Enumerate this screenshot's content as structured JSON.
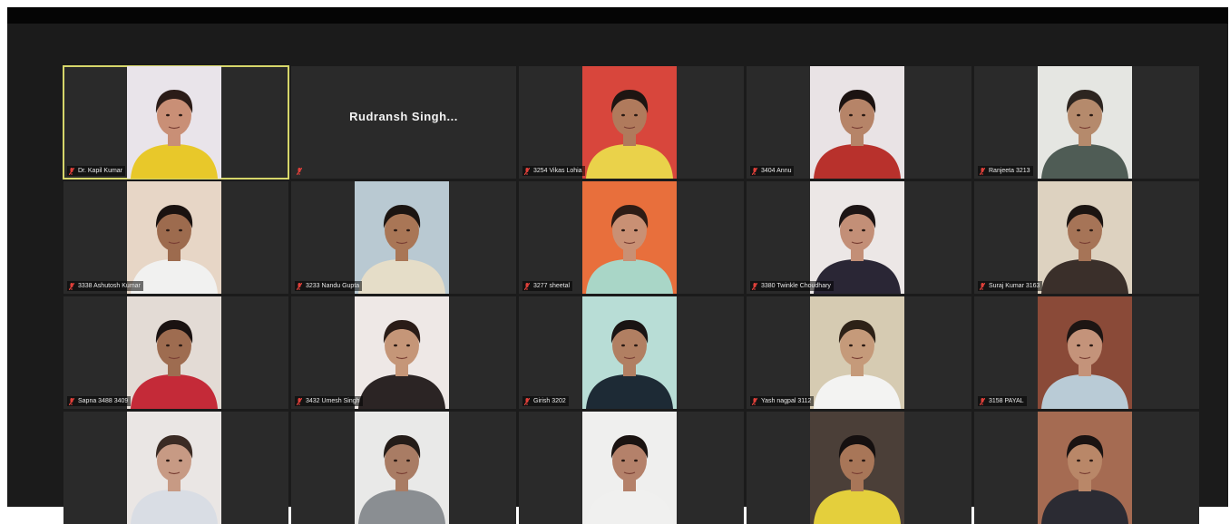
{
  "colors": {
    "tile_bg": "#2a2a2a",
    "active_speaker_border": "#d6d66a",
    "muted_mic": "#e0403a"
  },
  "participants": [
    {
      "label": "Dr. Kapil Kumar",
      "shirt": "#e8c82a",
      "wall": "#e9e4ea",
      "skin": "#c98f76",
      "hair": "#2b1c18",
      "active": true
    },
    {
      "name_display": "Rudransh  Singh...",
      "label": "",
      "no_video": true
    },
    {
      "label": "3254 Vikas Lohia",
      "shirt": "#ead24a",
      "wall": "#d8463c",
      "skin": "#b07a5c",
      "hair": "#1e1512"
    },
    {
      "label": "3404 Annu",
      "shirt": "#b8312c",
      "wall": "#e9e3e5",
      "skin": "#b68468",
      "hair": "#1c1311"
    },
    {
      "label": "Ranjeeta 3213",
      "shirt": "#4f5c55",
      "wall": "#e5e6e2",
      "skin": "#b58a6c",
      "hair": "#2d2520"
    },
    {
      "label": "3338 Ashutosh Kumar",
      "shirt": "#f1f1f0",
      "wall": "#e7d6c6",
      "skin": "#9d6b4e",
      "hair": "#1a1210"
    },
    {
      "label": "3233 Nandu Gupta",
      "shirt": "#e5ddc8",
      "wall": "#b9c9d2",
      "skin": "#a97656",
      "hair": "#1b1411"
    },
    {
      "label": "3277 sheetal",
      "shirt": "#a9d6c7",
      "wall": "#e86f3c",
      "skin": "#c99074",
      "hair": "#2e1c15"
    },
    {
      "label": "3380 Twinkle Choudhary",
      "shirt": "#2a2635",
      "wall": "#ece7e6",
      "skin": "#c38f77",
      "hair": "#1c1414"
    },
    {
      "label": "Suraj Kumar 3163",
      "shirt": "#3a2f2a",
      "wall": "#ddd2c0",
      "skin": "#a67457",
      "hair": "#1b1411"
    },
    {
      "label": "Sapna 3488 3409",
      "shirt": "#c42a38",
      "wall": "#e3dbd5",
      "skin": "#9e6c50",
      "hair": "#1a1211"
    },
    {
      "label": "3432 Umesh Singh",
      "shirt": "#2b2424",
      "wall": "#eee8e6",
      "skin": "#c59678",
      "hair": "#2a1c17"
    },
    {
      "label": "Girish 3202",
      "shirt": "#1d2a35",
      "wall": "#b8ddd6",
      "skin": "#b17f62",
      "hair": "#1a1413"
    },
    {
      "label": "Yash nagpal 3112",
      "shirt": "#f3f3f2",
      "wall": "#d6cbb2",
      "skin": "#c59a7a",
      "hair": "#2d2117"
    },
    {
      "label": "3158 PAYAL",
      "shirt": "#b9cbd6",
      "wall": "#8a4a38",
      "skin": "#c4937a",
      "hair": "#1d1513"
    },
    {
      "label": "",
      "shirt": "#d9dde4",
      "wall": "#eae6e4",
      "skin": "#c79a84",
      "hair": "#3b2b24"
    },
    {
      "label": "",
      "shirt": "#8a8e92",
      "wall": "#e9e9e8",
      "skin": "#a97c64",
      "hair": "#241c18"
    },
    {
      "label": "",
      "shirt": "#f0f0ef",
      "wall": "#efefee",
      "skin": "#b4816a",
      "hair": "#1a1311"
    },
    {
      "label": "",
      "shirt": "#e4cf3c",
      "wall": "#4b3f38",
      "skin": "#a87658",
      "hair": "#151010"
    },
    {
      "label": "",
      "shirt": "#2b2b33",
      "wall": "#a56b52",
      "skin": "#b98768",
      "hair": "#1a1312"
    }
  ]
}
